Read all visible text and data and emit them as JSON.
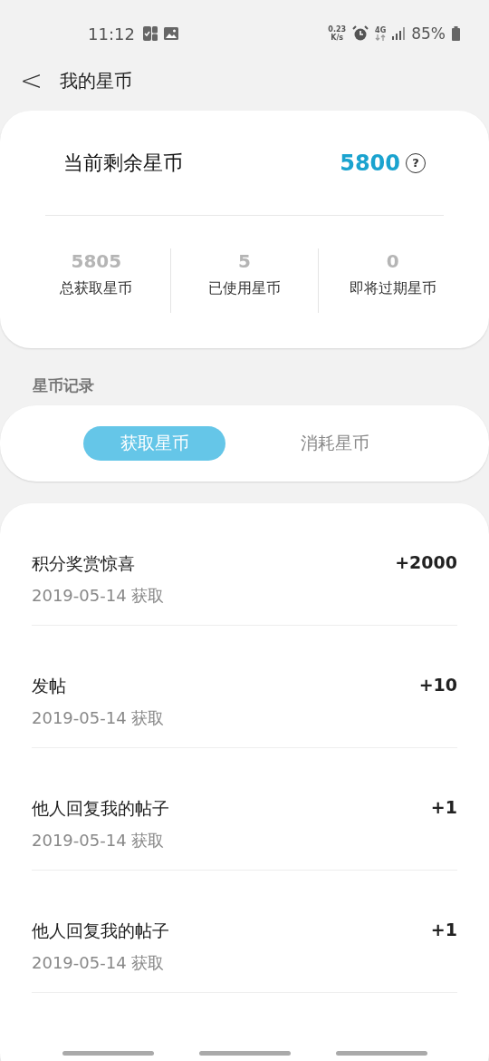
{
  "status_bar": {
    "time": "11:12",
    "speed_value": "0.23",
    "speed_unit": "K/s",
    "network": "4G",
    "battery": "85%"
  },
  "header": {
    "back": "<",
    "title": "我的星币"
  },
  "summary": {
    "label": "当前剩余星币",
    "value": "5800",
    "help": "?",
    "stats": [
      {
        "value": "5805",
        "label": "总获取星币"
      },
      {
        "value": "5",
        "label": "已使用星币"
      },
      {
        "value": "0",
        "label": "即将过期星币"
      }
    ]
  },
  "section_title": "星币记录",
  "tabs": [
    {
      "label": "获取星币",
      "selected": true
    },
    {
      "label": "消耗星币",
      "selected": false
    }
  ],
  "records": [
    {
      "title": "积分奖赏惊喜",
      "date": "2019-05-14 获取",
      "amount": "+2000"
    },
    {
      "title": "发帖",
      "date": "2019-05-14 获取",
      "amount": "+10"
    },
    {
      "title": "他人回复我的帖子",
      "date": "2019-05-14 获取",
      "amount": "+1"
    },
    {
      "title": "他人回复我的帖子",
      "date": "2019-05-14 获取",
      "amount": "+1"
    }
  ]
}
